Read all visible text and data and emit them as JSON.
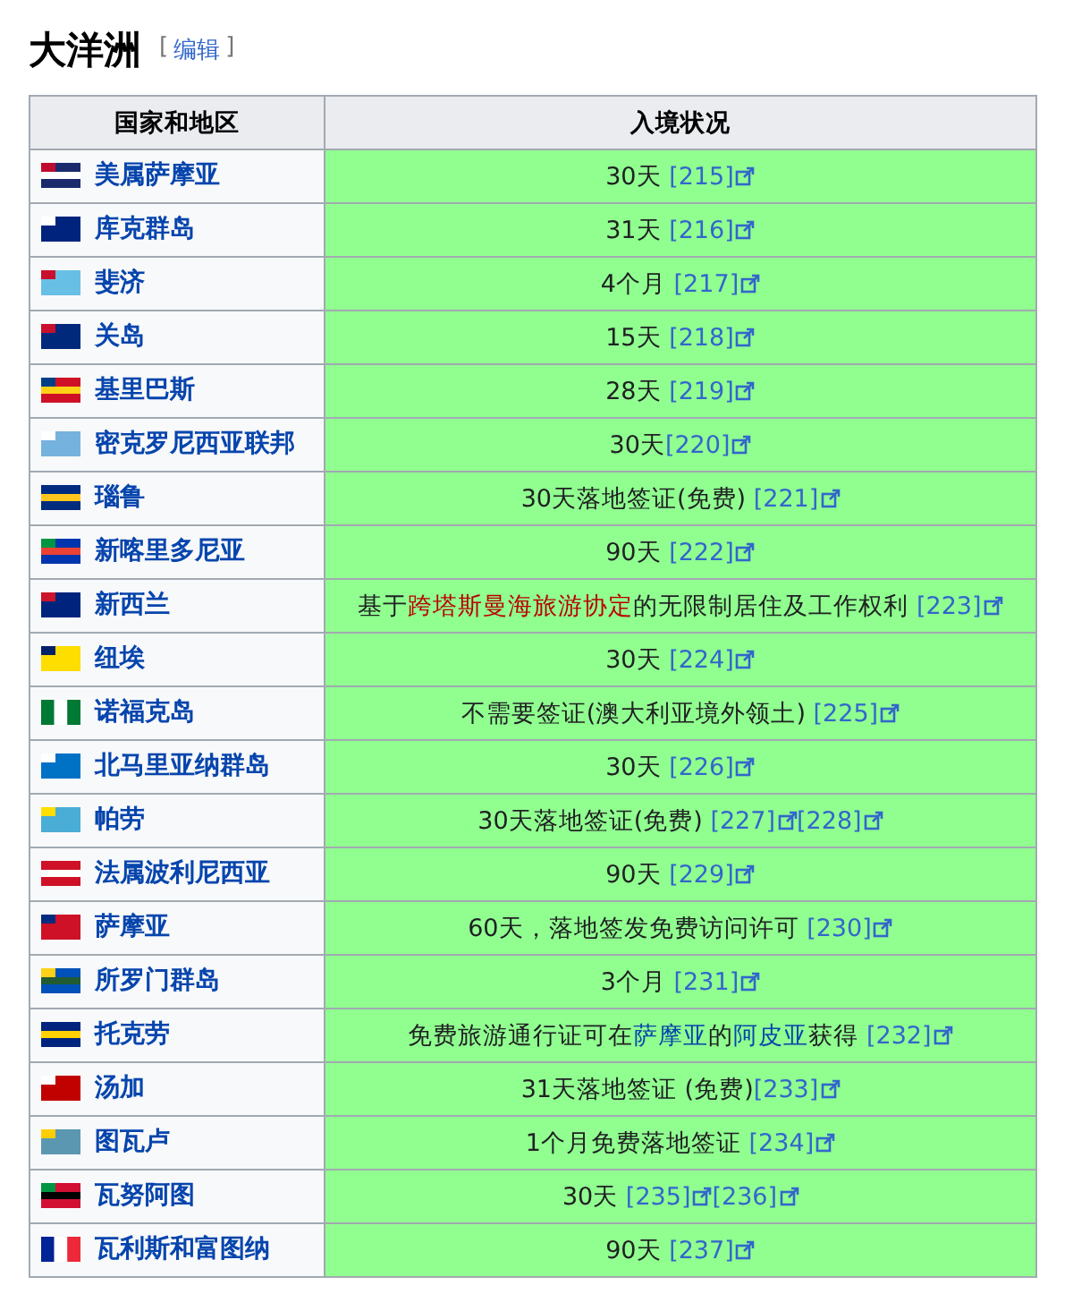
{
  "heading": {
    "title": "大洋洲",
    "edit_open": "[",
    "edit_link": "编辑",
    "edit_close": "]"
  },
  "table": {
    "columns": [
      "国家和地区",
      "入境状况"
    ],
    "rows": [
      {
        "country": "美属萨摩亚",
        "status": [
          {
            "kind": "text",
            "text": "30天 "
          }
        ],
        "refs": [
          "[215]"
        ]
      },
      {
        "country": "库克群岛",
        "status": [
          {
            "kind": "text",
            "text": "31天 "
          }
        ],
        "refs": [
          "[216]"
        ]
      },
      {
        "country": "斐济",
        "status": [
          {
            "kind": "text",
            "text": "4个月 "
          }
        ],
        "refs": [
          "[217]"
        ]
      },
      {
        "country": "关岛",
        "status": [
          {
            "kind": "text",
            "text": "15天 "
          }
        ],
        "refs": [
          "[218]"
        ]
      },
      {
        "country": "基里巴斯",
        "status": [
          {
            "kind": "text",
            "text": "28天 "
          }
        ],
        "refs": [
          "[219]"
        ]
      },
      {
        "country": "密克罗尼西亚联邦",
        "status": [
          {
            "kind": "text",
            "text": "30天"
          }
        ],
        "refs": [
          "[220]"
        ]
      },
      {
        "country": "瑙鲁",
        "status": [
          {
            "kind": "text",
            "text": "30天落地签证(免费) "
          }
        ],
        "refs": [
          "[221]"
        ]
      },
      {
        "country": "新喀里多尼亚",
        "status": [
          {
            "kind": "text",
            "text": "90天 "
          }
        ],
        "refs": [
          "[222]"
        ]
      },
      {
        "country": "新西兰",
        "status": [
          {
            "kind": "text",
            "text": "基于"
          },
          {
            "kind": "redlink",
            "text": "跨塔斯曼海旅游协定"
          },
          {
            "kind": "text",
            "text": "的无限制居住及工作权利 "
          }
        ],
        "refs": [
          "[223]"
        ]
      },
      {
        "country": "纽埃",
        "status": [
          {
            "kind": "text",
            "text": "30天 "
          }
        ],
        "refs": [
          "[224]"
        ]
      },
      {
        "country": "诺福克岛",
        "status": [
          {
            "kind": "text",
            "text": "不需要签证(澳大利亚境外领土) "
          }
        ],
        "refs": [
          "[225]"
        ]
      },
      {
        "country": "北马里亚纳群岛",
        "status": [
          {
            "kind": "text",
            "text": "30天 "
          }
        ],
        "refs": [
          "[226]"
        ]
      },
      {
        "country": "帕劳",
        "status": [
          {
            "kind": "text",
            "text": "30天落地签证(免费) "
          }
        ],
        "refs": [
          "[227]",
          "[228]"
        ]
      },
      {
        "country": "法属波利尼西亚",
        "status": [
          {
            "kind": "text",
            "text": "90天 "
          }
        ],
        "refs": [
          "[229]"
        ]
      },
      {
        "country": "萨摩亚",
        "status": [
          {
            "kind": "text",
            "text": "60天，落地签发免费访问许可 "
          }
        ],
        "refs": [
          "[230]"
        ]
      },
      {
        "country": "所罗门群岛",
        "status": [
          {
            "kind": "text",
            "text": "3个月 "
          }
        ],
        "refs": [
          "[231]"
        ]
      },
      {
        "country": "托克劳",
        "status": [
          {
            "kind": "text",
            "text": "免费旅游通行证可在"
          },
          {
            "kind": "link",
            "text": "萨摩亚"
          },
          {
            "kind": "text",
            "text": "的"
          },
          {
            "kind": "link",
            "text": "阿皮亚"
          },
          {
            "kind": "text",
            "text": "获得 "
          }
        ],
        "refs": [
          "[232]"
        ]
      },
      {
        "country": "汤加",
        "status": [
          {
            "kind": "text",
            "text": "31天落地签证 (免费)"
          }
        ],
        "refs": [
          "[233]"
        ]
      },
      {
        "country": "图瓦卢",
        "status": [
          {
            "kind": "text",
            "text": "1个月免费落地签证 "
          }
        ],
        "refs": [
          "[234]"
        ]
      },
      {
        "country": "瓦努阿图",
        "status": [
          {
            "kind": "text",
            "text": "30天 "
          }
        ],
        "refs": [
          "[235]",
          "[236]"
        ]
      },
      {
        "country": "瓦利斯和富图纳",
        "status": [
          {
            "kind": "text",
            "text": "90天 "
          }
        ],
        "refs": [
          "[237]"
        ]
      }
    ]
  }
}
